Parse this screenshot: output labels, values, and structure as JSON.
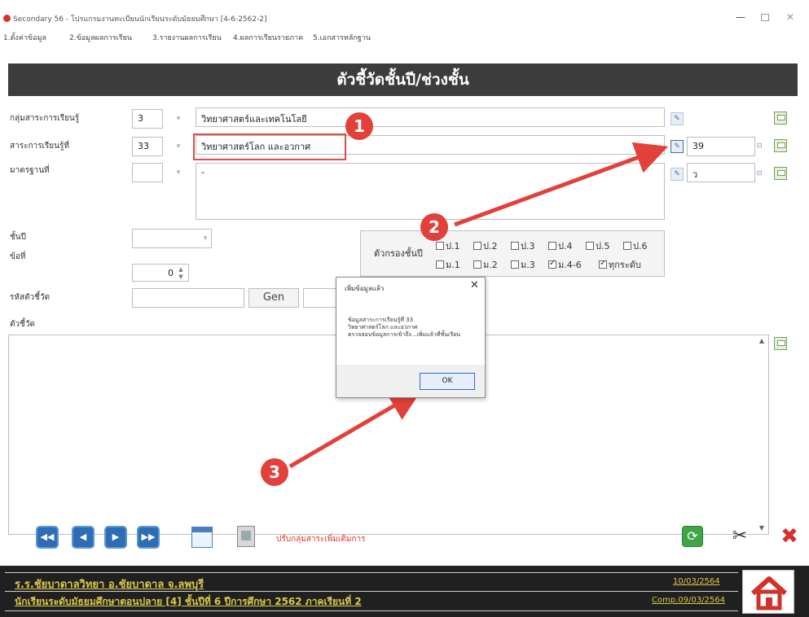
{
  "window": {
    "title": "Secondary 56 - โปรแกรมงานทะเบียนนักเรียนระดับมัธยมศึกษา [4-6-2562-2]",
    "minimize": "—",
    "close": "✕"
  },
  "menu": [
    "1.ตั้งค่าข้อมูล",
    "2.ข้อมูลผลการเรียน",
    "3.รายงานผลการเรียน",
    "4.ผลการเรียนรายภาค",
    "5.เอกสารหลักฐาน"
  ],
  "header": {
    "title": "ตัวชี้วัดชั้นปี/ช่วงชั้น"
  },
  "form": {
    "subject_group": {
      "label": "กลุ่มสาระการเรียนรู้",
      "code": "3",
      "name": "วิทยาศาสตร์และเทคโนโลยี"
    },
    "strand": {
      "label": "สาระการเรียนรู้ที่",
      "code": "33",
      "name": "วิทยาศาสตร์โลก และอวกาศ",
      "number": "39"
    },
    "standard": {
      "label": "มาตรฐานที่",
      "code": "",
      "text": "-",
      "number": "ว"
    },
    "grade": {
      "label": "ชั้นปี",
      "value": ""
    },
    "item_no": {
      "label": "ข้อที่",
      "value": "0"
    },
    "indicator_code": {
      "label": "รหัสตัวชี้วัด",
      "gen_label": "Gen"
    },
    "indicator": {
      "label": "ตัวชี้วัด"
    }
  },
  "filter": {
    "label": "ตัวกรองชั้นปี",
    "row1": [
      {
        "label": "ป.1",
        "checked": false
      },
      {
        "label": "ป.2",
        "checked": false
      },
      {
        "label": "ป.3",
        "checked": false
      },
      {
        "label": "ป.4",
        "checked": false
      },
      {
        "label": "ป.5",
        "checked": false
      },
      {
        "label": "ป.6",
        "checked": false
      }
    ],
    "row2": [
      {
        "label": "ม.1",
        "checked": false
      },
      {
        "label": "ม.2",
        "checked": false
      },
      {
        "label": "ม.3",
        "checked": false
      },
      {
        "label": "ม.4-6",
        "checked": true
      },
      {
        "label": "ทุกระดับ",
        "checked": true
      }
    ]
  },
  "dialog": {
    "title": "เพิ่มข้อมูลแล้ว",
    "message_lines": [
      "ข้อมูลสาระการเรียนรู้ที่ 33",
      "วิทยาศาสตร์โลก และอวกาศ",
      "ตรวจสอบข้อมูลการเข้าถึง...เพิ่มแล้วที่ชั้นเรียน"
    ],
    "ok_label": "OK",
    "close": "✕"
  },
  "annotations": {
    "badge1": "1",
    "badge2": "2",
    "badge3": "3",
    "arrow_color": "#e2413a"
  },
  "toolbar": {
    "first": "◀◀",
    "prev": "◀",
    "next": "▶",
    "last": "▶▶",
    "adjust_label": "ปรับกลุ่มสาระเพิ่มเติมการ",
    "refresh": "⟳",
    "cut": "✂",
    "close": "✖"
  },
  "status": {
    "school": "ร.ร.ชัยบาดาลวิทยา  อ.ชัยบาดาล  จ.ลพบุรี",
    "level": "นักเรียนระดับมัธยมศึกษาตอนปลาย [4]  ชั้นปีที่ 6  ปีการศึกษา 2562  ภาคเรียนที่ 2",
    "date_current": "10/03/2564",
    "date_comp": "Comp.09/03/2564",
    "accent": "#d9c94a"
  },
  "icons": [
    "app-icon",
    "save-icon",
    "edit-icon",
    "first-icon",
    "prev-icon",
    "next-icon",
    "last-icon",
    "form-icon",
    "print-icon",
    "refresh-icon",
    "scissors-icon",
    "close-icon",
    "home-icon"
  ]
}
